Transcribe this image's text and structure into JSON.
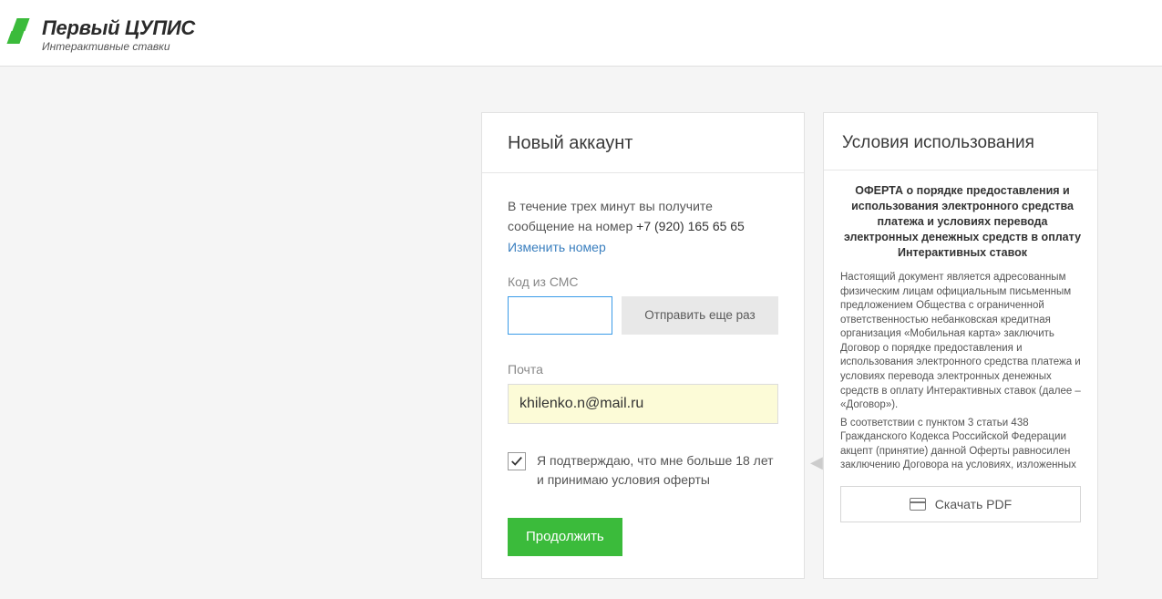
{
  "header": {
    "logo_title": "Первый ЦУПИС",
    "logo_subtitle": "Интерактивные ставки"
  },
  "form": {
    "title": "Новый аккаунт",
    "info_line1": "В течение трех минут вы получите",
    "info_line2_prefix": "сообщение на номер ",
    "phone": "+7 (920) 165 65 65",
    "change_number": "Изменить номер",
    "sms_label": "Код из СМС",
    "sms_value": "",
    "resend_label": "Отправить еще раз",
    "email_label": "Почта",
    "email_value": "khilenko.n@mail.ru",
    "confirm_text": "Я подтверждаю, что мне больше 18 лет и принимаю условия оферты",
    "continue_label": "Продолжить"
  },
  "terms": {
    "title": "Условия использования",
    "offer_heading": "ОФЕРТА о порядке предоставления и использования электронного средства платежа и условиях перевода электронных денежных средств в оплату Интерактивных ставок",
    "body_p1": "Настоящий документ является адресованным физическим лицам официальным письменным предложением Общества с ограниченной ответственностью небанковская кредитная организация «Мобильная карта» заключить Договор о порядке предоставления и использования электронного средства платежа и условиях перевода электронных денежных средств в оплату Интерактивных ставок (далее – «Договор»).",
    "body_p2": "В соответствии с пунктом 3 статьи 438 Гражданского Кодекса Российской Федерации акцепт (принятие) данной Оферты равносилен заключению Договора на условиях, изложенных в Оферте. Договор считается заключённым и приобретает силу с",
    "download_label": "Скачать PDF"
  }
}
